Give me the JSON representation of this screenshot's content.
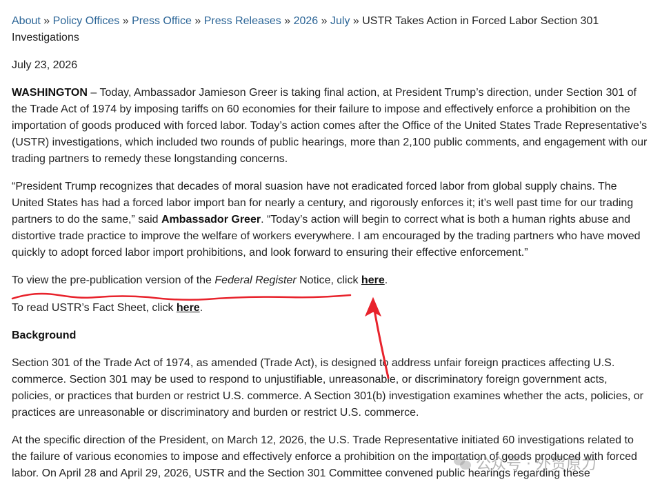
{
  "breadcrumb": {
    "items": [
      "About",
      "Policy Offices",
      "Press Office",
      "Press Releases",
      "2026",
      "July"
    ],
    "separator": "»",
    "current": "USTR Takes Action in Forced Labor Section 301 Investigations"
  },
  "date": "July 23, 2026",
  "para1": {
    "dateline": "WASHINGTON",
    "text": " – Today, Ambassador Jamieson Greer is taking final action, at President Trump’s direction, under Section 301 of the Trade Act of 1974 by imposing tariffs on 60 economies for their failure to impose and effectively enforce a prohibition on the importation of goods produced with forced labor.  Today’s action comes after the Office of the United States Trade Representative’s (USTR) investigations, which included two rounds of public hearings, more than 2,100 public comments, and engagement with our trading partners to remedy these longstanding concerns."
  },
  "para2": {
    "quote1": "“President Trump recognizes that decades of moral suasion have not eradicated forced labor from global supply chains.  The United States has had a forced labor import ban for nearly a century, and rigorously enforces it; it’s well past time for our trading partners to do the same,” said ",
    "speaker": "Ambassador Greer",
    "quote2": ".  “Today’s action will begin to correct what is both a human rights abuse and distortive trade practice to improve the welfare of workers everywhere.  I am encouraged by the trading partners who have moved quickly to adopt forced labor import prohibitions, and look forward to ensuring their effective enforcement.”"
  },
  "notice_line": {
    "prefix": "To view the pre-publication version of the ",
    "italic": "Federal Register",
    "middle": " Notice, click ",
    "link": "here",
    "suffix": "."
  },
  "factsheet_line": {
    "prefix": "To read USTR’s Fact Sheet, click ",
    "link": "here",
    "suffix": "."
  },
  "background_heading": "Background",
  "para_background": "Section 301 of the Trade Act of 1974, as amended (Trade Act), is designed to address unfair foreign practices affecting U.S. commerce.  Section 301 may be used to respond to unjustifiable, unreasonable, or discriminatory foreign government acts, policies, or practices that burden or restrict U.S. commerce.  A Section 301(b) investigation examines whether the acts, policies, or practices are unreasonable or discriminatory and burden or restrict U.S. commerce.",
  "para_last": "At the specific direction of the President, on March 12, 2026, the U.S. Trade Representative initiated 60 investigations related to the failure of various economies to impose and effectively enforce a prohibition on the importation of goods produced with forced labor.  On April 28 and April 29, 2026, USTR and the Section 301 Committee convened public hearings regarding these",
  "watermark": {
    "text": "公众号 · 外贸原力",
    "icon": "wechat-logo-icon"
  },
  "annotation": {
    "color": "#e8232c"
  }
}
